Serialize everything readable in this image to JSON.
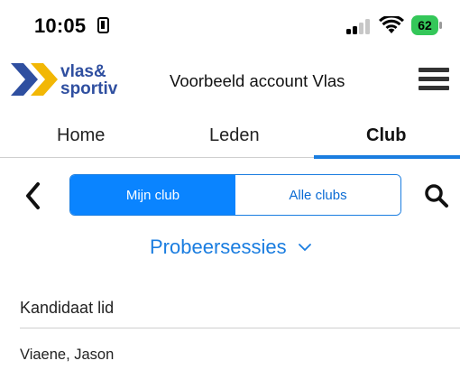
{
  "status_bar": {
    "time": "10:05",
    "battery_level": "62",
    "signal_bars": 2
  },
  "header": {
    "logo_line1": "vlas&",
    "logo_line2": "sportiv",
    "account_name": "Voorbeeld account Vlas"
  },
  "tabs": [
    {
      "label": "Home",
      "active": false
    },
    {
      "label": "Leden",
      "active": false
    },
    {
      "label": "Club",
      "active": true
    }
  ],
  "segment": {
    "active_label": "Mijn club",
    "inactive_label": "Alle clubs"
  },
  "dropdown": {
    "label": "Probeersessies"
  },
  "list": {
    "section_header": "Kandidaat lid",
    "items": [
      "Viaene, Jason"
    ]
  },
  "colors": {
    "accent": "#1a7de0",
    "segment_active": "#0a84ff",
    "logo_blue": "#2f4fa0",
    "logo_yellow": "#f2b705",
    "battery_green": "#34c759"
  }
}
